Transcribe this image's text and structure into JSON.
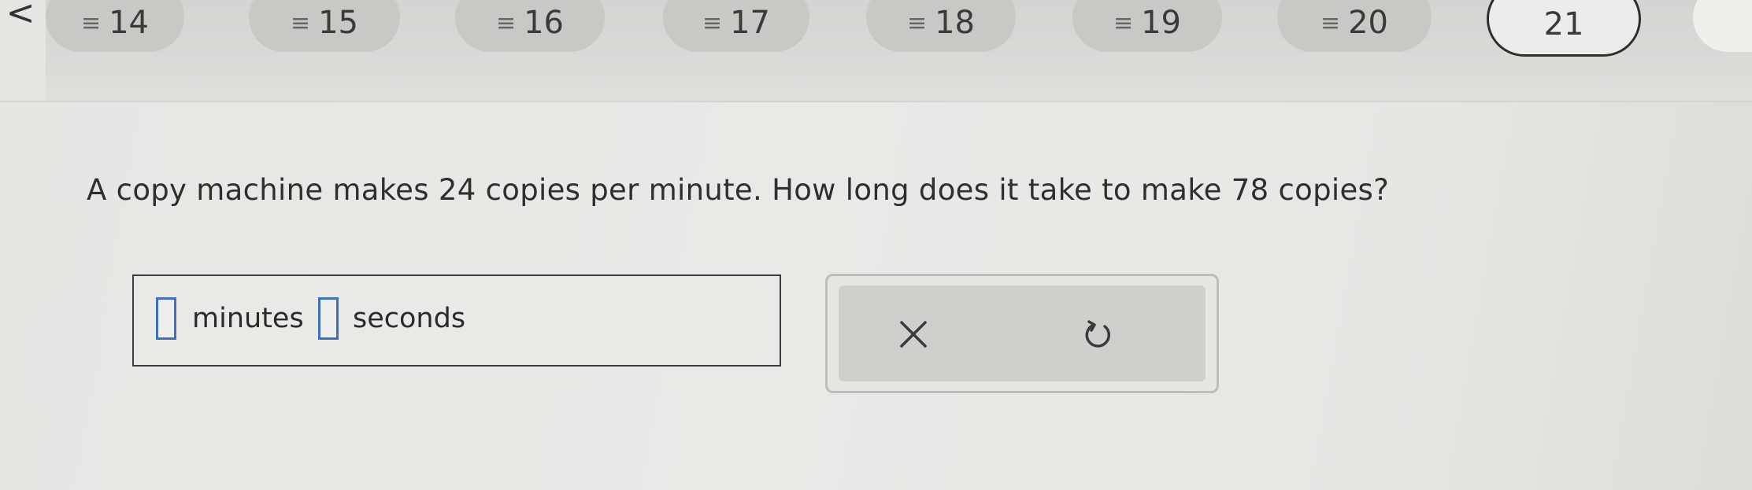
{
  "nav": {
    "back_label": "<",
    "questions": [
      {
        "number": "14",
        "status": "answered"
      },
      {
        "number": "15",
        "status": "answered"
      },
      {
        "number": "16",
        "status": "answered"
      },
      {
        "number": "17",
        "status": "answered"
      },
      {
        "number": "18",
        "status": "answered"
      },
      {
        "number": "19",
        "status": "answered"
      },
      {
        "number": "20",
        "status": "answered"
      },
      {
        "number": "21",
        "status": "current"
      }
    ]
  },
  "question": {
    "text": "A copy machine makes 24 copies per minute. How long does it take to make 78 copies?"
  },
  "answer": {
    "minutes_value": "",
    "minutes_unit": "minutes",
    "seconds_value": "",
    "seconds_unit": "seconds"
  },
  "tools": {
    "clear_icon": "close-icon",
    "undo_icon": "undo-icon"
  },
  "colors": {
    "input_border": "#3d6fc4",
    "current_pill_border": "#2e2e2e"
  }
}
